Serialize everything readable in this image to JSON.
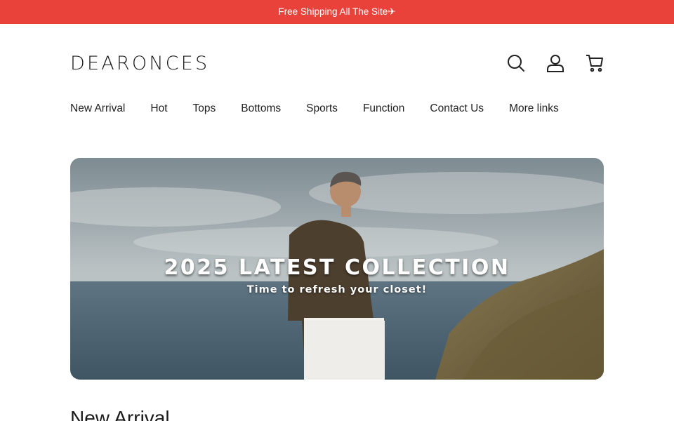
{
  "announcement": {
    "text": "Free Shipping All The Site✈"
  },
  "header": {
    "logo": "DEARONCES",
    "icons": [
      "search-icon",
      "account-icon",
      "cart-icon"
    ]
  },
  "nav": {
    "items": [
      {
        "label": "New Arrival"
      },
      {
        "label": "Hot"
      },
      {
        "label": "Tops"
      },
      {
        "label": "Bottoms"
      },
      {
        "label": "Sports"
      },
      {
        "label": "Function"
      },
      {
        "label": "Contact Us"
      },
      {
        "label": "More links"
      }
    ]
  },
  "hero": {
    "title": "2025 LATEST COLLECTION",
    "subtitle": "Time to refresh your closet!"
  },
  "section": {
    "title": "New Arrival"
  },
  "colors": {
    "announcement_bg": "#e9423a",
    "text": "#222222"
  }
}
